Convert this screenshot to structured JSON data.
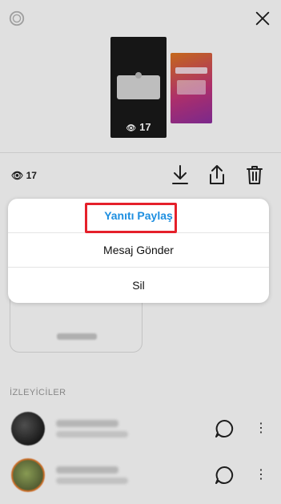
{
  "story": {
    "thumbnail_view_count": "17"
  },
  "stats": {
    "view_count": "17"
  },
  "sheet": {
    "items": [
      {
        "label": "Yanıtı Paylaş"
      },
      {
        "label": "Mesaj Gönder"
      },
      {
        "label": "Sil"
      }
    ]
  },
  "viewers": {
    "section_label": "İZLEYİCİLER"
  },
  "colors": {
    "primary_action": "#1e8fe0",
    "highlight_border": "#e5202a"
  },
  "icons": {
    "top_left": "settings-gear-icon",
    "top_right": "close-icon",
    "download": "download-icon",
    "share": "share-icon",
    "delete": "trash-icon",
    "message": "message-bubble-icon",
    "more": "more-vertical-icon",
    "views": "eye-icon"
  }
}
